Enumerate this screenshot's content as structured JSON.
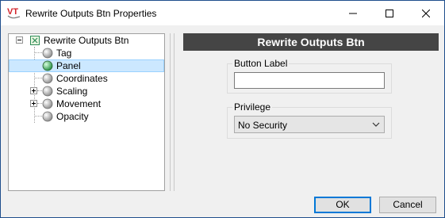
{
  "window": {
    "title": "Rewrite Outputs Btn Properties",
    "app_logo_text": "VT",
    "controls": [
      "minimize-icon",
      "maximize-icon",
      "close-icon"
    ]
  },
  "tree": {
    "root": {
      "label": "Rewrite Outputs Btn",
      "expanded": true,
      "icon": "object-node-icon"
    },
    "items": [
      {
        "label": "Tag",
        "expandable": false,
        "selected": false,
        "icon": "gray-ball-icon"
      },
      {
        "label": "Panel",
        "expandable": false,
        "selected": true,
        "icon": "green-ball-icon"
      },
      {
        "label": "Coordinates",
        "expandable": false,
        "selected": false,
        "icon": "gray-ball-icon"
      },
      {
        "label": "Scaling",
        "expandable": true,
        "selected": false,
        "icon": "gray-ball-icon"
      },
      {
        "label": "Movement",
        "expandable": true,
        "selected": false,
        "icon": "gray-ball-icon"
      },
      {
        "label": "Opacity",
        "expandable": false,
        "selected": false,
        "icon": "gray-ball-icon"
      }
    ]
  },
  "main": {
    "header": "Rewrite Outputs Btn",
    "button_label": {
      "legend": "Button Label",
      "value": ""
    },
    "privilege": {
      "legend": "Privilege",
      "selected": "No Security"
    }
  },
  "footer": {
    "ok_label": "OK",
    "cancel_label": "Cancel"
  },
  "colors": {
    "header_bg": "#454545",
    "selection_bg": "#cce8ff",
    "accent": "#0078d7",
    "logo_red": "#d2232a"
  }
}
